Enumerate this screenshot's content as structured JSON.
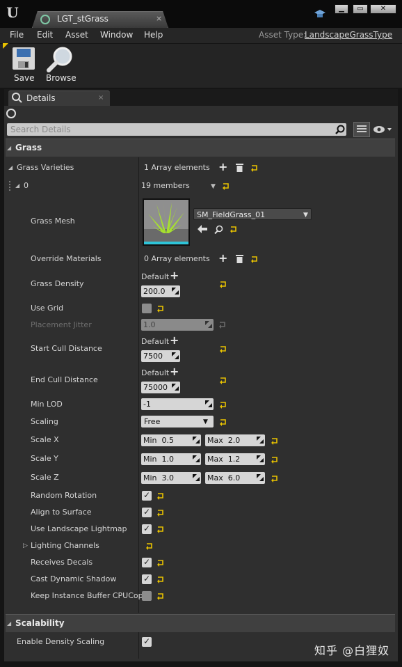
{
  "titlebar": {
    "tab_title": "LGT_stGrass",
    "tab_close": "×",
    "win_min": "▁",
    "win_max": "▭",
    "win_close": "✕"
  },
  "menu": {
    "items": [
      "File",
      "Edit",
      "Asset",
      "Window",
      "Help"
    ],
    "asset_type_label": "Asset Type:",
    "asset_type_value": "LandscapeGrassType"
  },
  "toolbar": {
    "save_label": "Save",
    "browse_label": "Browse"
  },
  "details": {
    "tab_label": "Details",
    "tab_close": "×",
    "search_placeholder": "Search Details"
  },
  "grass_category": "Grass",
  "grass_varieties": {
    "label": "Grass Varieties",
    "value": "1 Array elements"
  },
  "element0": {
    "label": "0",
    "value": "19 members"
  },
  "grass_mesh": {
    "label": "Grass Mesh",
    "value": "SM_FieldGrass_01"
  },
  "override_materials": {
    "label": "Override Materials",
    "value": "0 Array elements"
  },
  "grass_density": {
    "label": "Grass Density",
    "default": "Default",
    "value": "200.0"
  },
  "use_grid": {
    "label": "Use Grid",
    "checked": false
  },
  "placement_jitter": {
    "label": "Placement Jitter",
    "value": "1.0"
  },
  "start_cull": {
    "label": "Start Cull Distance",
    "default": "Default",
    "value": "7500"
  },
  "end_cull": {
    "label": "End Cull Distance",
    "default": "Default",
    "value": "75000"
  },
  "min_lod": {
    "label": "Min LOD",
    "value": "-1"
  },
  "scaling": {
    "label": "Scaling",
    "value": "Free"
  },
  "scale_x": {
    "label": "Scale X",
    "min_label": "Min",
    "min": "0.5",
    "max_label": "Max",
    "max": "2.0"
  },
  "scale_y": {
    "label": "Scale Y",
    "min_label": "Min",
    "min": "1.0",
    "max_label": "Max",
    "max": "1.2"
  },
  "scale_z": {
    "label": "Scale Z",
    "min_label": "Min",
    "min": "3.0",
    "max_label": "Max",
    "max": "6.0"
  },
  "random_rotation": {
    "label": "Random Rotation",
    "checked": true
  },
  "align_surface": {
    "label": "Align to Surface",
    "checked": true
  },
  "use_landscape_lightmap": {
    "label": "Use Landscape Lightmap",
    "checked": true
  },
  "lighting_channels": {
    "label": "Lighting Channels"
  },
  "receives_decals": {
    "label": "Receives Decals",
    "checked": true
  },
  "cast_dynamic_shadow": {
    "label": "Cast Dynamic Shadow",
    "checked": true
  },
  "keep_instance_buffer": {
    "label": "Keep Instance Buffer CPUCopy",
    "checked": false
  },
  "scalability_category": "Scalability",
  "enable_density_scaling": {
    "label": "Enable Density Scaling",
    "checked": true
  },
  "watermark": "知乎 @白狸奴",
  "check_glyph": "✓"
}
